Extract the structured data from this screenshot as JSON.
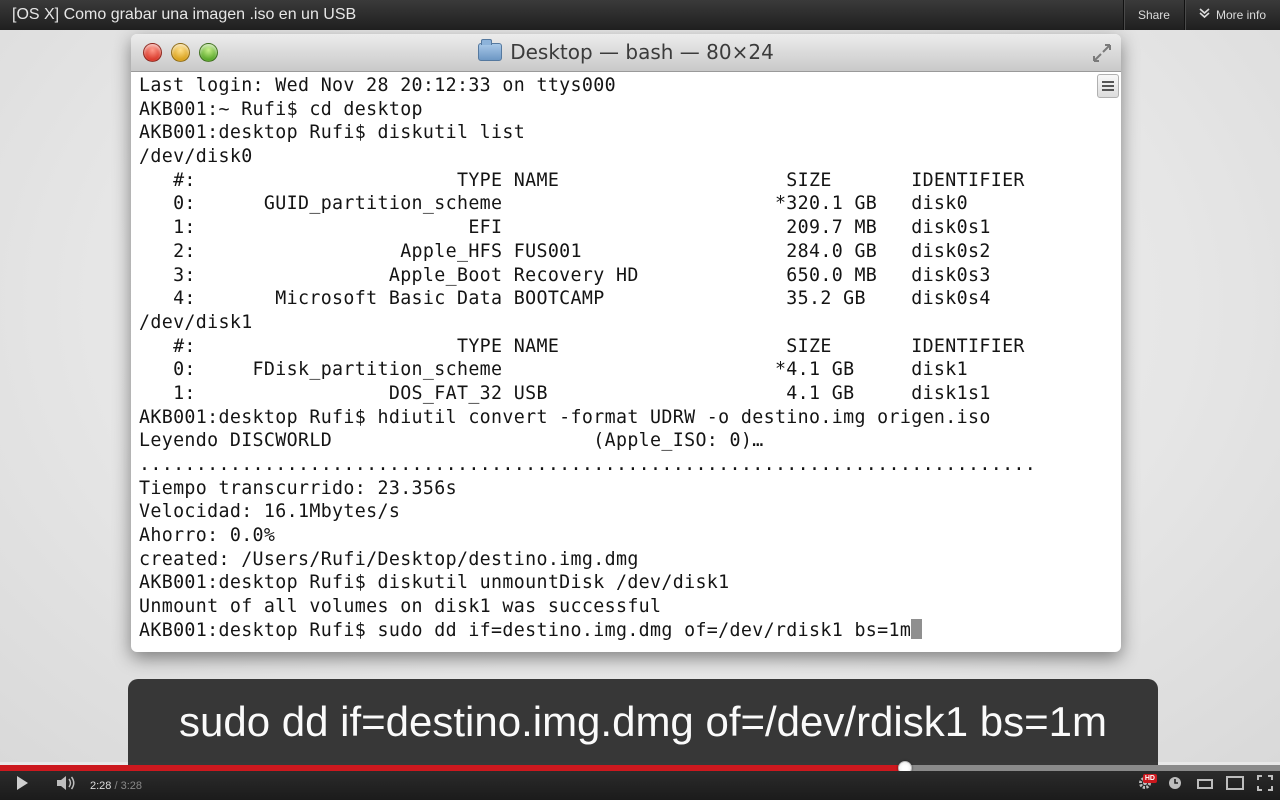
{
  "video": {
    "title": "[OS X] Como grabar una imagen .iso en un USB",
    "share_label": "Share",
    "more_info_label": "More info"
  },
  "terminal": {
    "window_title": "Desktop — bash — 80×24",
    "lines": [
      "Last login: Wed Nov 28 20:12:33 on ttys000",
      "AKB001:~ Rufi$ cd desktop",
      "AKB001:desktop Rufi$ diskutil list",
      "/dev/disk0",
      "   #:                       TYPE NAME                    SIZE       IDENTIFIER",
      "   0:      GUID_partition_scheme                        *320.1 GB   disk0",
      "   1:                        EFI                         209.7 MB   disk0s1",
      "   2:                  Apple_HFS FUS001                  284.0 GB   disk0s2",
      "   3:                 Apple_Boot Recovery HD             650.0 MB   disk0s3",
      "   4:       Microsoft Basic Data BOOTCAMP                35.2 GB    disk0s4",
      "/dev/disk1",
      "   #:                       TYPE NAME                    SIZE       IDENTIFIER",
      "   0:     FDisk_partition_scheme                        *4.1 GB     disk1",
      "   1:                 DOS_FAT_32 USB                     4.1 GB     disk1s1",
      "AKB001:desktop Rufi$ hdiutil convert -format UDRW -o destino.img origen.iso",
      "Leyendo DISCWORLD                       (Apple_ISO: 0)…",
      "...............................................................................",
      "Tiempo transcurrido: 23.356s",
      "Velocidad: 16.1Mbytes/s",
      "Ahorro: 0.0%",
      "created: /Users/Rufi/Desktop/destino.img.dmg",
      "AKB001:desktop Rufi$ diskutil unmountDisk /dev/disk1",
      "Unmount of all volumes on disk1 was successful",
      "AKB001:desktop Rufi$ sudo dd if=destino.img.dmg of=/dev/rdisk1 bs=1m"
    ]
  },
  "caption": {
    "text": "sudo dd if=destino.img.dmg of=/dev/rdisk1 bs=1m"
  },
  "player": {
    "current_time": "2:28",
    "separator": " / ",
    "duration": "3:28",
    "progress_fraction": 0.707,
    "hd_badge": "HD",
    "accent_color": "#cc181e"
  },
  "icons": {
    "play": "play-icon",
    "volume": "volume-icon",
    "settings": "gear-icon",
    "watch_later": "clock-icon",
    "small_player": "small-player-icon",
    "large_player": "large-player-icon",
    "fullscreen": "fullscreen-icon",
    "more_info": "chevron-down-icon"
  }
}
